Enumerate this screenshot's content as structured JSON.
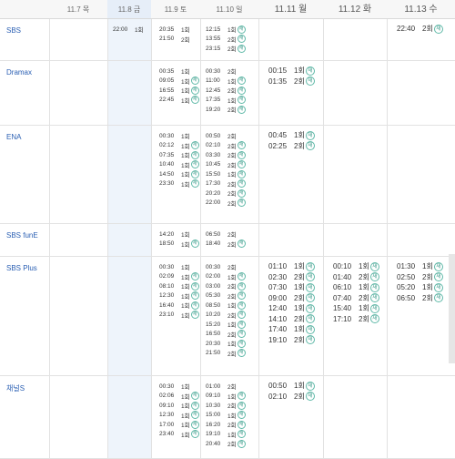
{
  "dates": [
    {
      "label": "11.7 목",
      "size": "sm"
    },
    {
      "label": "11.8 금",
      "size": "sm",
      "highlight": true
    },
    {
      "label": "11.9 토",
      "size": "sm"
    },
    {
      "label": "11.10 일",
      "size": "sm"
    },
    {
      "label": "11.11 월",
      "size": "lg"
    },
    {
      "label": "11.12 화",
      "size": "lg"
    },
    {
      "label": "11.13 수",
      "size": "lg"
    }
  ],
  "rerun_badge": "재",
  "channels": [
    {
      "name": "SBS",
      "days": [
        [],
        [
          {
            "time": "22:00",
            "ep": "1회"
          }
        ],
        [
          {
            "time": "20:35",
            "ep": "1회",
            "re": false
          },
          {
            "time": "21:50",
            "ep": "2회",
            "re": false
          }
        ],
        [
          {
            "time": "12:15",
            "ep": "1회",
            "re": true
          },
          {
            "time": "13:55",
            "ep": "2회",
            "re": true
          },
          {
            "time": "23:15",
            "ep": "2회",
            "re": true
          }
        ],
        [],
        [],
        [
          {
            "time": "22:40",
            "ep": "2회",
            "re": true
          }
        ]
      ]
    },
    {
      "name": "Dramax",
      "days": [
        [],
        [],
        [
          {
            "time": "00:35",
            "ep": "1회"
          },
          {
            "time": "09:05",
            "ep": "1회",
            "re": true
          },
          {
            "time": "16:55",
            "ep": "1회",
            "re": true
          },
          {
            "time": "22:45",
            "ep": "1회",
            "re": true
          }
        ],
        [
          {
            "time": "00:30",
            "ep": "2회"
          },
          {
            "time": "11:00",
            "ep": "1회",
            "re": true
          },
          {
            "time": "12:45",
            "ep": "2회",
            "re": true
          },
          {
            "time": "17:35",
            "ep": "1회",
            "re": true
          },
          {
            "time": "19:20",
            "ep": "2회",
            "re": true
          }
        ],
        [
          {
            "time": "00:15",
            "ep": "1회",
            "re": true
          },
          {
            "time": "01:35",
            "ep": "2회",
            "re": true
          }
        ],
        [],
        []
      ]
    },
    {
      "name": "ENA",
      "days": [
        [],
        [],
        [
          {
            "time": "00:30",
            "ep": "1회"
          },
          {
            "time": "02:12",
            "ep": "1회",
            "re": true
          },
          {
            "time": "07:35",
            "ep": "1회",
            "re": true
          },
          {
            "time": "10:40",
            "ep": "1회",
            "re": true
          },
          {
            "time": "14:50",
            "ep": "1회",
            "re": true
          },
          {
            "time": "23:30",
            "ep": "1회",
            "re": true
          }
        ],
        [
          {
            "time": "00:50",
            "ep": "2회"
          },
          {
            "time": "02:10",
            "ep": "2회",
            "re": true
          },
          {
            "time": "03:30",
            "ep": "2회",
            "re": true
          },
          {
            "time": "10:45",
            "ep": "2회",
            "re": true
          },
          {
            "time": "15:50",
            "ep": "1회",
            "re": true
          },
          {
            "time": "17:30",
            "ep": "2회",
            "re": true
          },
          {
            "time": "20:20",
            "ep": "2회",
            "re": true
          },
          {
            "time": "22:00",
            "ep": "2회",
            "re": true
          }
        ],
        [
          {
            "time": "00:45",
            "ep": "1회",
            "re": true
          },
          {
            "time": "02:25",
            "ep": "2회",
            "re": true
          }
        ],
        [],
        []
      ]
    },
    {
      "name": "SBS funE",
      "days": [
        [],
        [],
        [
          {
            "time": "14:20",
            "ep": "1회"
          },
          {
            "time": "18:50",
            "ep": "1회",
            "re": true
          }
        ],
        [
          {
            "time": "06:50",
            "ep": "2회"
          },
          {
            "time": "18:40",
            "ep": "2회",
            "re": true
          }
        ],
        [],
        [],
        []
      ]
    },
    {
      "name": "SBS Plus",
      "days": [
        [],
        [],
        [
          {
            "time": "00:30",
            "ep": "1회"
          },
          {
            "time": "02:09",
            "ep": "1회",
            "re": true
          },
          {
            "time": "08:10",
            "ep": "1회",
            "re": true
          },
          {
            "time": "12:30",
            "ep": "1회",
            "re": true
          },
          {
            "time": "16:40",
            "ep": "1회",
            "re": true
          },
          {
            "time": "23:10",
            "ep": "1회",
            "re": true
          }
        ],
        [
          {
            "time": "00:30",
            "ep": "2회"
          },
          {
            "time": "02:00",
            "ep": "1회",
            "re": true
          },
          {
            "time": "03:00",
            "ep": "2회",
            "re": true
          },
          {
            "time": "05:30",
            "ep": "2회",
            "re": true
          },
          {
            "time": "08:50",
            "ep": "1회",
            "re": true
          },
          {
            "time": "10:20",
            "ep": "2회",
            "re": true
          },
          {
            "time": "15:20",
            "ep": "1회",
            "re": true
          },
          {
            "time": "16:50",
            "ep": "2회",
            "re": true
          },
          {
            "time": "20:30",
            "ep": "1회",
            "re": true
          },
          {
            "time": "21:50",
            "ep": "2회",
            "re": true
          }
        ],
        [
          {
            "time": "01:10",
            "ep": "1회",
            "re": true
          },
          {
            "time": "02:30",
            "ep": "2회",
            "re": true
          },
          {
            "time": "07:30",
            "ep": "1회",
            "re": true
          },
          {
            "time": "09:00",
            "ep": "2회",
            "re": true
          },
          {
            "time": "12:40",
            "ep": "1회",
            "re": true
          },
          {
            "time": "14:10",
            "ep": "2회",
            "re": true
          },
          {
            "time": "17:40",
            "ep": "1회",
            "re": true
          },
          {
            "time": "19:10",
            "ep": "2회",
            "re": true
          }
        ],
        [
          {
            "time": "00:10",
            "ep": "1회",
            "re": true
          },
          {
            "time": "01:40",
            "ep": "2회",
            "re": true
          },
          {
            "time": "06:10",
            "ep": "1회",
            "re": true
          },
          {
            "time": "07:40",
            "ep": "2회",
            "re": true
          },
          {
            "time": "15:40",
            "ep": "1회",
            "re": true
          },
          {
            "time": "17:10",
            "ep": "2회",
            "re": true
          }
        ],
        [
          {
            "time": "01:30",
            "ep": "1회",
            "re": true
          },
          {
            "time": "02:50",
            "ep": "2회",
            "re": true
          },
          {
            "time": "05:20",
            "ep": "1회",
            "re": true
          },
          {
            "time": "06:50",
            "ep": "2회",
            "re": true
          }
        ]
      ]
    },
    {
      "name": "채널S",
      "days": [
        [],
        [],
        [
          {
            "time": "00:30",
            "ep": "1회"
          },
          {
            "time": "02:06",
            "ep": "1회",
            "re": true
          },
          {
            "time": "09:10",
            "ep": "1회",
            "re": true
          },
          {
            "time": "12:30",
            "ep": "1회",
            "re": true
          },
          {
            "time": "17:00",
            "ep": "1회",
            "re": true
          },
          {
            "time": "23:40",
            "ep": "1회",
            "re": true
          }
        ],
        [
          {
            "time": "01:00",
            "ep": "2회"
          },
          {
            "time": "09:10",
            "ep": "1회",
            "re": true
          },
          {
            "time": "10:30",
            "ep": "2회",
            "re": true
          },
          {
            "time": "15:00",
            "ep": "1회",
            "re": true
          },
          {
            "time": "16:20",
            "ep": "2회",
            "re": true
          },
          {
            "time": "19:10",
            "ep": "1회",
            "re": true
          },
          {
            "time": "20:40",
            "ep": "2회",
            "re": true
          }
        ],
        [
          {
            "time": "00:50",
            "ep": "1회",
            "re": true
          },
          {
            "time": "02:10",
            "ep": "2회",
            "re": true
          }
        ],
        [],
        []
      ]
    }
  ]
}
